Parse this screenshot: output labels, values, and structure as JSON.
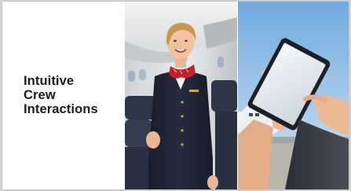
{
  "slide": {
    "title_lines": [
      "Intuitive",
      "Crew",
      "Interactions"
    ]
  },
  "images": {
    "crew_photo": "flight-attendant-in-aircraft-cabin",
    "tablet_photo": "hand-touching-tablet-with-aircraft-background"
  },
  "colors": {
    "title_text": "#1c1c1c",
    "uniform": "#1f2438",
    "scarf": "#c4202b",
    "sky": "#7fb6e3"
  }
}
